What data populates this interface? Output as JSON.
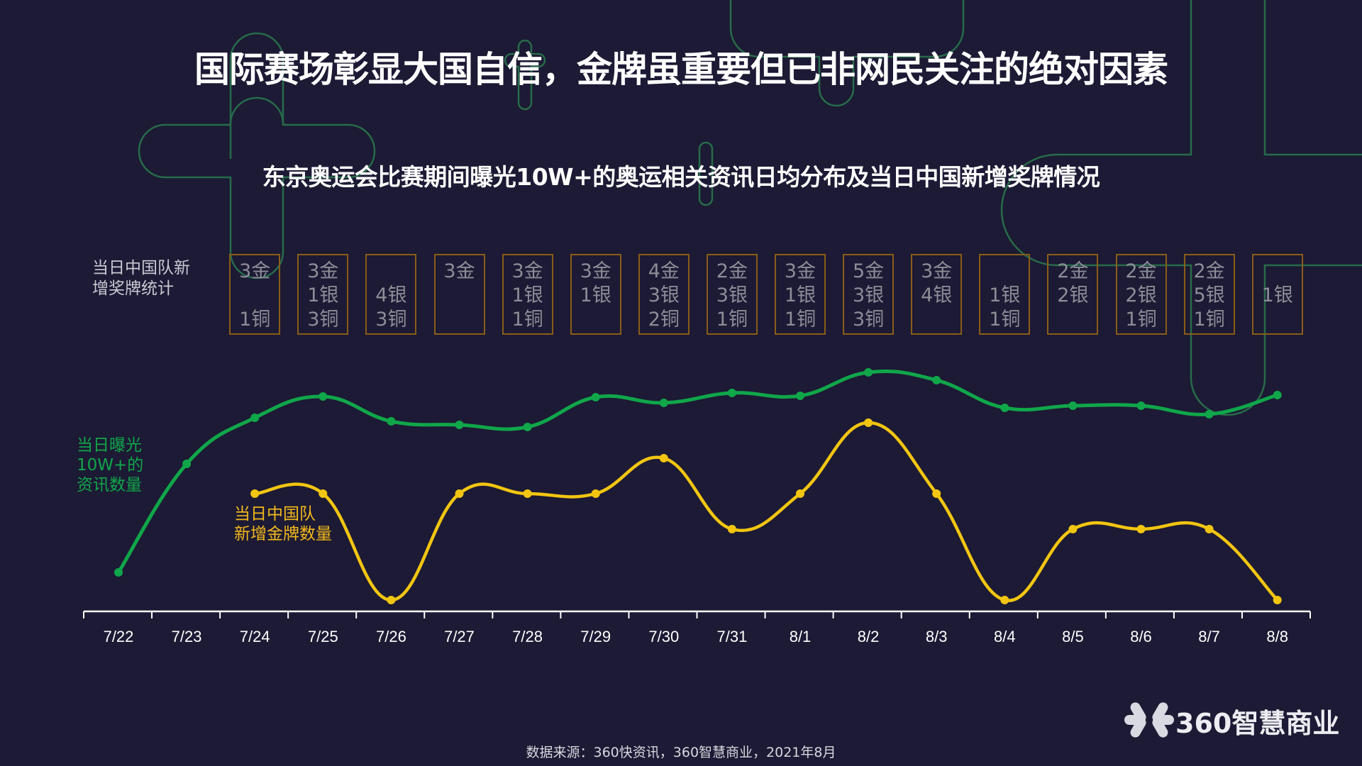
{
  "header": {
    "title": "国际赛场彰显大国自信，金牌虽重要但已非网民关注的绝对因素",
    "subtitle": "东京奥运会比赛期间曝光10W+的奥运相关资讯日均分布及当日中国新增奖牌情况"
  },
  "medal_table": {
    "row_label_line1": "当日中国队新",
    "row_label_line2": "增奖牌统计",
    "boxes": [
      {
        "date": "7/24",
        "gold": "3金",
        "silver": "",
        "bronze": "1铜"
      },
      {
        "date": "7/25",
        "gold": "3金",
        "silver": "1银",
        "bronze": "3铜"
      },
      {
        "date": "7/26",
        "gold": "",
        "silver": "4银",
        "bronze": "3铜"
      },
      {
        "date": "7/27",
        "gold": "3金",
        "silver": "",
        "bronze": ""
      },
      {
        "date": "7/28",
        "gold": "3金",
        "silver": "1银",
        "bronze": "1铜"
      },
      {
        "date": "7/29",
        "gold": "3金",
        "silver": "1银",
        "bronze": ""
      },
      {
        "date": "7/30",
        "gold": "4金",
        "silver": "3银",
        "bronze": "2铜"
      },
      {
        "date": "7/31",
        "gold": "2金",
        "silver": "3银",
        "bronze": "1铜"
      },
      {
        "date": "8/1",
        "gold": "3金",
        "silver": "1银",
        "bronze": "1铜"
      },
      {
        "date": "8/2",
        "gold": "5金",
        "silver": "3银",
        "bronze": "3铜"
      },
      {
        "date": "8/3",
        "gold": "3金",
        "silver": "4银",
        "bronze": ""
      },
      {
        "date": "8/4",
        "gold": "",
        "silver": "1银",
        "bronze": "1铜"
      },
      {
        "date": "8/5",
        "gold": "2金",
        "silver": "2银",
        "bronze": ""
      },
      {
        "date": "8/6",
        "gold": "2金",
        "silver": "2银",
        "bronze": "1铜"
      },
      {
        "date": "8/7",
        "gold": "2金",
        "silver": "5银",
        "bronze": "1铜"
      },
      {
        "date": "8/8",
        "gold": "",
        "silver": "1银",
        "bronze": ""
      }
    ]
  },
  "chart_data": {
    "type": "line",
    "title": "东京奥运会比赛期间曝光10W+的奥运相关资讯日均分布及当日中国新增奖牌情况",
    "xlabel": "",
    "ylabel": "",
    "x": [
      "7/22",
      "7/23",
      "7/24",
      "7/25",
      "7/26",
      "7/27",
      "7/28",
      "7/29",
      "7/30",
      "7/31",
      "8/1",
      "8/2",
      "8/3",
      "8/4",
      "8/5",
      "8/6",
      "8/7",
      "8/8"
    ],
    "grid": false,
    "legend": "inline-left",
    "series": [
      {
        "name": "当日曝光10W+的资讯数量",
        "label_lines": [
          "当日曝光",
          "10W+的",
          "资讯数量"
        ],
        "color": "#10a64a",
        "unit": "relative index (no axis scale shown)",
        "values": [
          55,
          208,
          273,
          303,
          268,
          263,
          260,
          302,
          294,
          308,
          304,
          337,
          326,
          287,
          290,
          290,
          278,
          305
        ]
      },
      {
        "name": "当日中国队新增金牌数量",
        "label_lines": [
          "当日中国队",
          "新增金牌数量"
        ],
        "color": "#f2c511",
        "unit": "gold medals",
        "start_index": 2,
        "values": [
          null,
          null,
          3,
          3,
          0,
          3,
          3,
          3,
          4,
          2,
          3,
          5,
          3,
          0,
          2,
          2,
          2,
          0
        ]
      }
    ],
    "ylim_series_1": [
      0,
      360
    ],
    "ylim_series_2": [
      0,
      7
    ]
  },
  "footer": {
    "source": "数据来源：360快资讯，360智慧商业，2021年8月"
  },
  "logo": {
    "text": "360智慧商业",
    "icon": "360-flower-logo-icon"
  }
}
